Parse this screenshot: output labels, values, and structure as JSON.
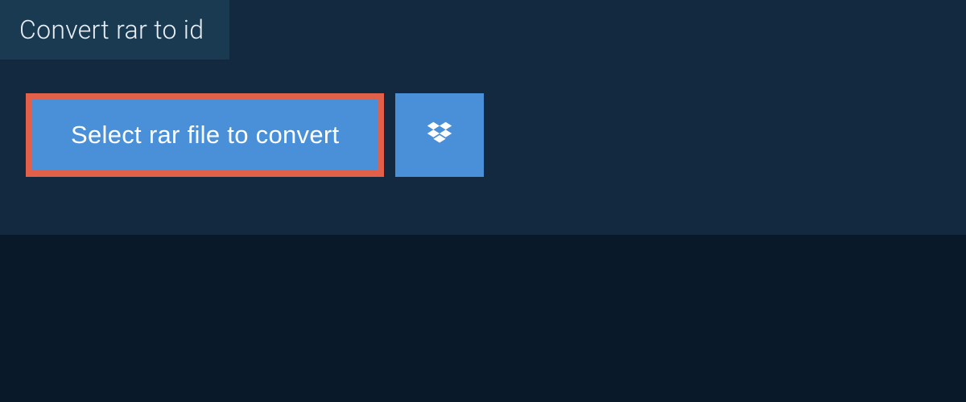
{
  "tab": {
    "title": "Convert rar to id"
  },
  "actions": {
    "select_file_label": "Select rar file to convert"
  },
  "colors": {
    "page_bg": "#0a1929",
    "panel_bg": "#13293f",
    "tab_bg": "#1a3a52",
    "button_bg": "#4a90d9",
    "highlight_border": "#e2604a",
    "text_light": "#e8eef4",
    "text_white": "#ffffff"
  },
  "icons": {
    "dropbox": "dropbox-icon"
  }
}
